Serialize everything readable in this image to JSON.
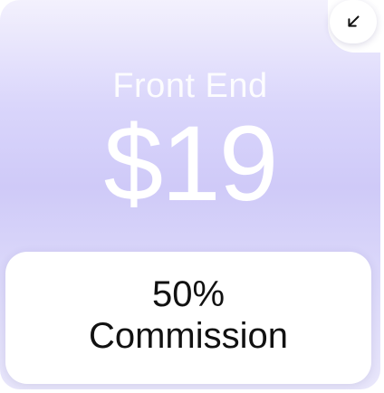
{
  "card": {
    "title": "Front End",
    "price": "$19"
  },
  "corner_button": {
    "icon": "arrow-down-left-icon"
  },
  "commission": {
    "percent": "50%",
    "label": "Commission"
  },
  "colors": {
    "gradient_light": "#f3f1fd",
    "gradient_mid": "#cfcaf8",
    "text_light": "#ffffff",
    "text_dark": "#111111"
  }
}
